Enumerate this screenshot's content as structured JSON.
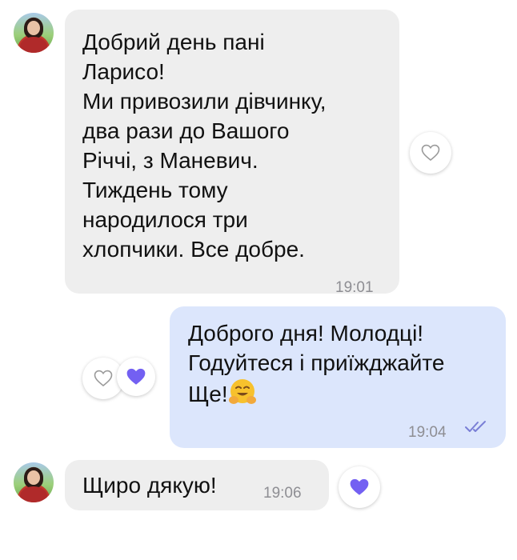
{
  "messages": [
    {
      "direction": "incoming",
      "text": "Добрий день пані\nЛарисо!\nМи привозили дівчинку,\nдва рази до Вашого\nРіччі, з Маневич.\nТиждень тому\nнародилося три\nхлопчики. Все добре.",
      "time": "19:01",
      "reaction": "heart-outline"
    },
    {
      "direction": "outgoing",
      "text_lines": [
        "Доброго дня! Молодці!",
        "Годуйтеся і приїжджайте",
        "Ще!"
      ],
      "emoji": "hugging-face-emoji",
      "time": "19:04",
      "status": "read",
      "reactions": [
        "heart-outline",
        "heart-filled"
      ]
    },
    {
      "direction": "incoming",
      "text": "Щиро дякую!",
      "time": "19:06",
      "reaction": "heart-filled"
    }
  ],
  "colors": {
    "incoming_bubble": "#eeeeee",
    "outgoing_bubble": "#dce6fc",
    "accent_heart": "#7360f2",
    "read_check": "#7a7fd6",
    "timestamp": "#8e8e93"
  }
}
